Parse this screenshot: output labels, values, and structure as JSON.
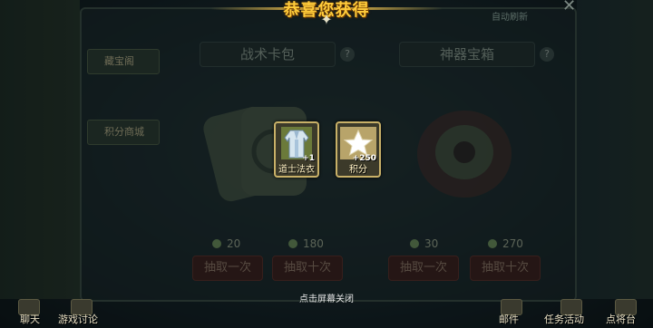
{
  "banner": {
    "title": "恭喜您获得"
  },
  "header": {
    "right_label": "自动刷新",
    "close_glyph": "✕"
  },
  "side_tabs": [
    {
      "label": "藏宝阁"
    },
    {
      "label": "积分商城"
    }
  ],
  "panels": [
    {
      "title": "战术卡包",
      "costs": [
        "20",
        "180"
      ],
      "buttons": [
        "抽取一次",
        "抽取十次"
      ]
    },
    {
      "title": "神器宝箱",
      "costs": [
        "30",
        "270"
      ],
      "buttons": [
        "抽取一次",
        "抽取十次"
      ]
    }
  ],
  "rewards": [
    {
      "name": "道士法衣",
      "qty": "+1",
      "icon": "robe-icon"
    },
    {
      "name": "积分",
      "qty": "+250",
      "icon": "star-icon"
    }
  ],
  "close_hint": "点击屏幕关闭",
  "bottom_nav": {
    "left": [
      "聊天",
      "游戏讨论"
    ],
    "right": [
      "邮件",
      "任务活动",
      "点将台"
    ]
  },
  "colors": {
    "gold": "#ffcc3b",
    "frame": "#c9b168",
    "button_bg": "#3b1e1a"
  }
}
